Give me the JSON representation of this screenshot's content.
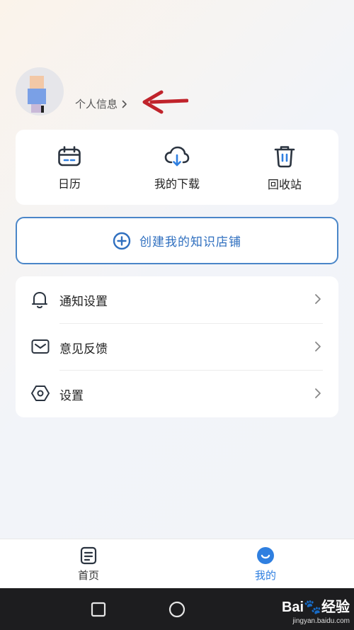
{
  "profile": {
    "link_label": "个人信息",
    "chevron": "chevron-right-icon"
  },
  "quick_actions": [
    {
      "label": "日历",
      "icon": "calendar-icon"
    },
    {
      "label": "我的下载",
      "icon": "cloud-download-icon"
    },
    {
      "label": "回收站",
      "icon": "trash-icon"
    }
  ],
  "create_store": {
    "label": "创建我的知识店铺",
    "icon": "plus-circle-icon",
    "accent": "#2f6fbf"
  },
  "menu": [
    {
      "label": "通知设置",
      "icon": "bell-icon"
    },
    {
      "label": "意见反馈",
      "icon": "envelope-icon"
    },
    {
      "label": "设置",
      "icon": "hexagon-settings-icon"
    }
  ],
  "tabbar": {
    "tabs": [
      {
        "label": "首页",
        "icon": "document-icon"
      },
      {
        "label": "我的",
        "icon": "smile-icon",
        "active": true
      }
    ]
  },
  "watermark": {
    "brand": "Bai🐾经验",
    "url": "jingyan.baidu.com"
  },
  "colors": {
    "accent_blue": "#2f7fe0",
    "annotation_arrow": "#c0232b"
  }
}
